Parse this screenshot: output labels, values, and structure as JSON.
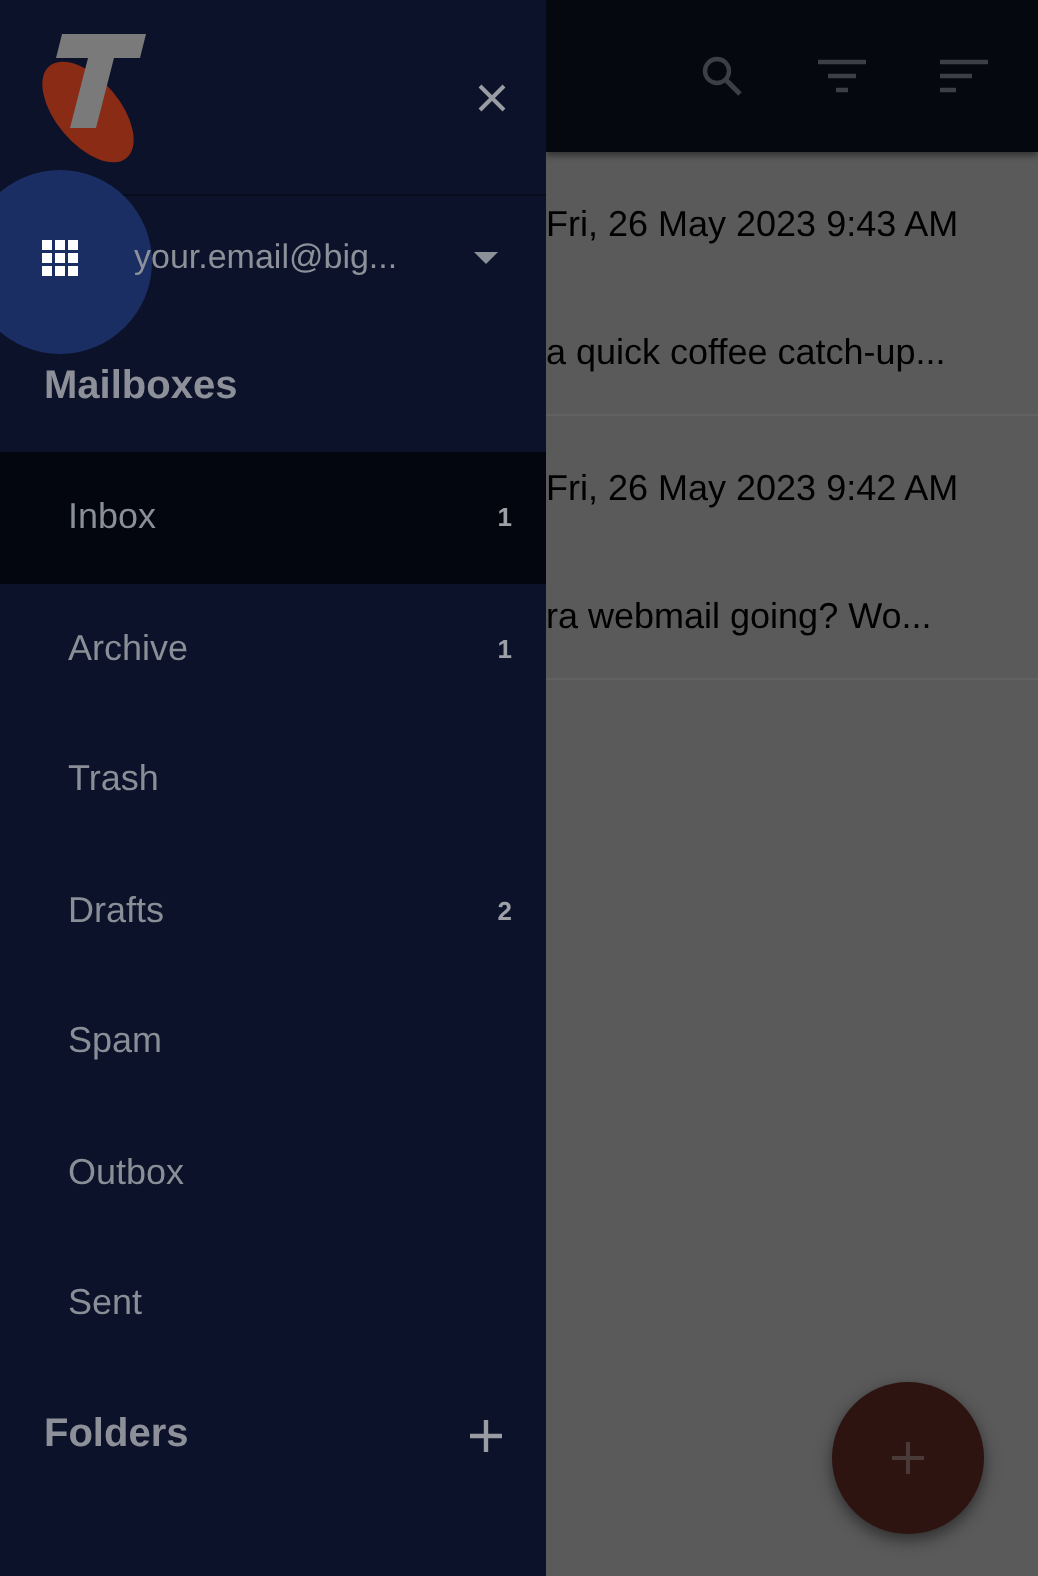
{
  "drawer": {
    "account": {
      "email": "your.email@big..."
    },
    "mailboxes_heading": "Mailboxes",
    "mailboxes": [
      {
        "label": "Inbox",
        "count": "1",
        "selected": true
      },
      {
        "label": "Archive",
        "count": "1",
        "selected": false
      },
      {
        "label": "Trash",
        "selected": false
      },
      {
        "label": "Drafts",
        "count": "2",
        "selected": false
      },
      {
        "label": "Spam",
        "selected": false
      },
      {
        "label": "Outbox",
        "selected": false
      },
      {
        "label": "Sent",
        "selected": false
      }
    ],
    "folders_heading": "Folders"
  },
  "messages": [
    {
      "date": "Fri, 26 May 2023 9:43 AM",
      "snippet": "a quick coffee catch-up..."
    },
    {
      "date": "Fri, 26 May 2023 9:42 AM",
      "snippet": "ra webmail going? Wo..."
    }
  ]
}
